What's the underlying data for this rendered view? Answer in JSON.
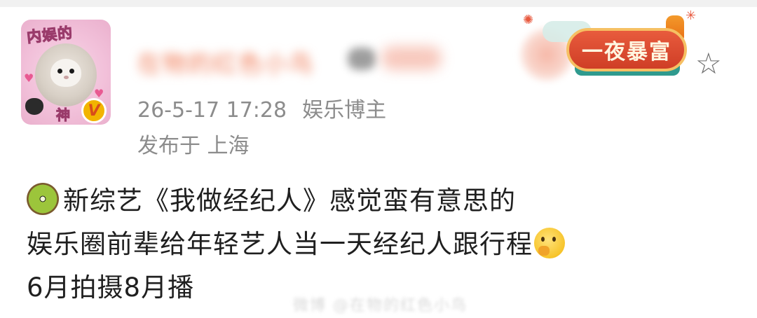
{
  "header": {
    "username": "在物的红色小鸟",
    "timestamp": "26-5-17 17:28",
    "author_tag": "娱乐博主",
    "location": "发布于 上海"
  },
  "avatar": {
    "top_text": "内娱的",
    "bottom_text": "神",
    "badge_text": "V"
  },
  "decoration": {
    "badge_text": "一夜暴富"
  },
  "icons": {
    "favorite": "star-outline-icon",
    "emoji_start": "kiwi-icon",
    "emoji_thinking": "thinking-face-icon"
  },
  "post": {
    "line1": "新综艺《我做经纪人》感觉蛮有意思的",
    "line2": "娱乐圈前辈给年轻艺人当一天经纪人跟行程",
    "line3": "6月拍摄8月播"
  },
  "watermark": "微博 @在物的红色小鸟"
}
